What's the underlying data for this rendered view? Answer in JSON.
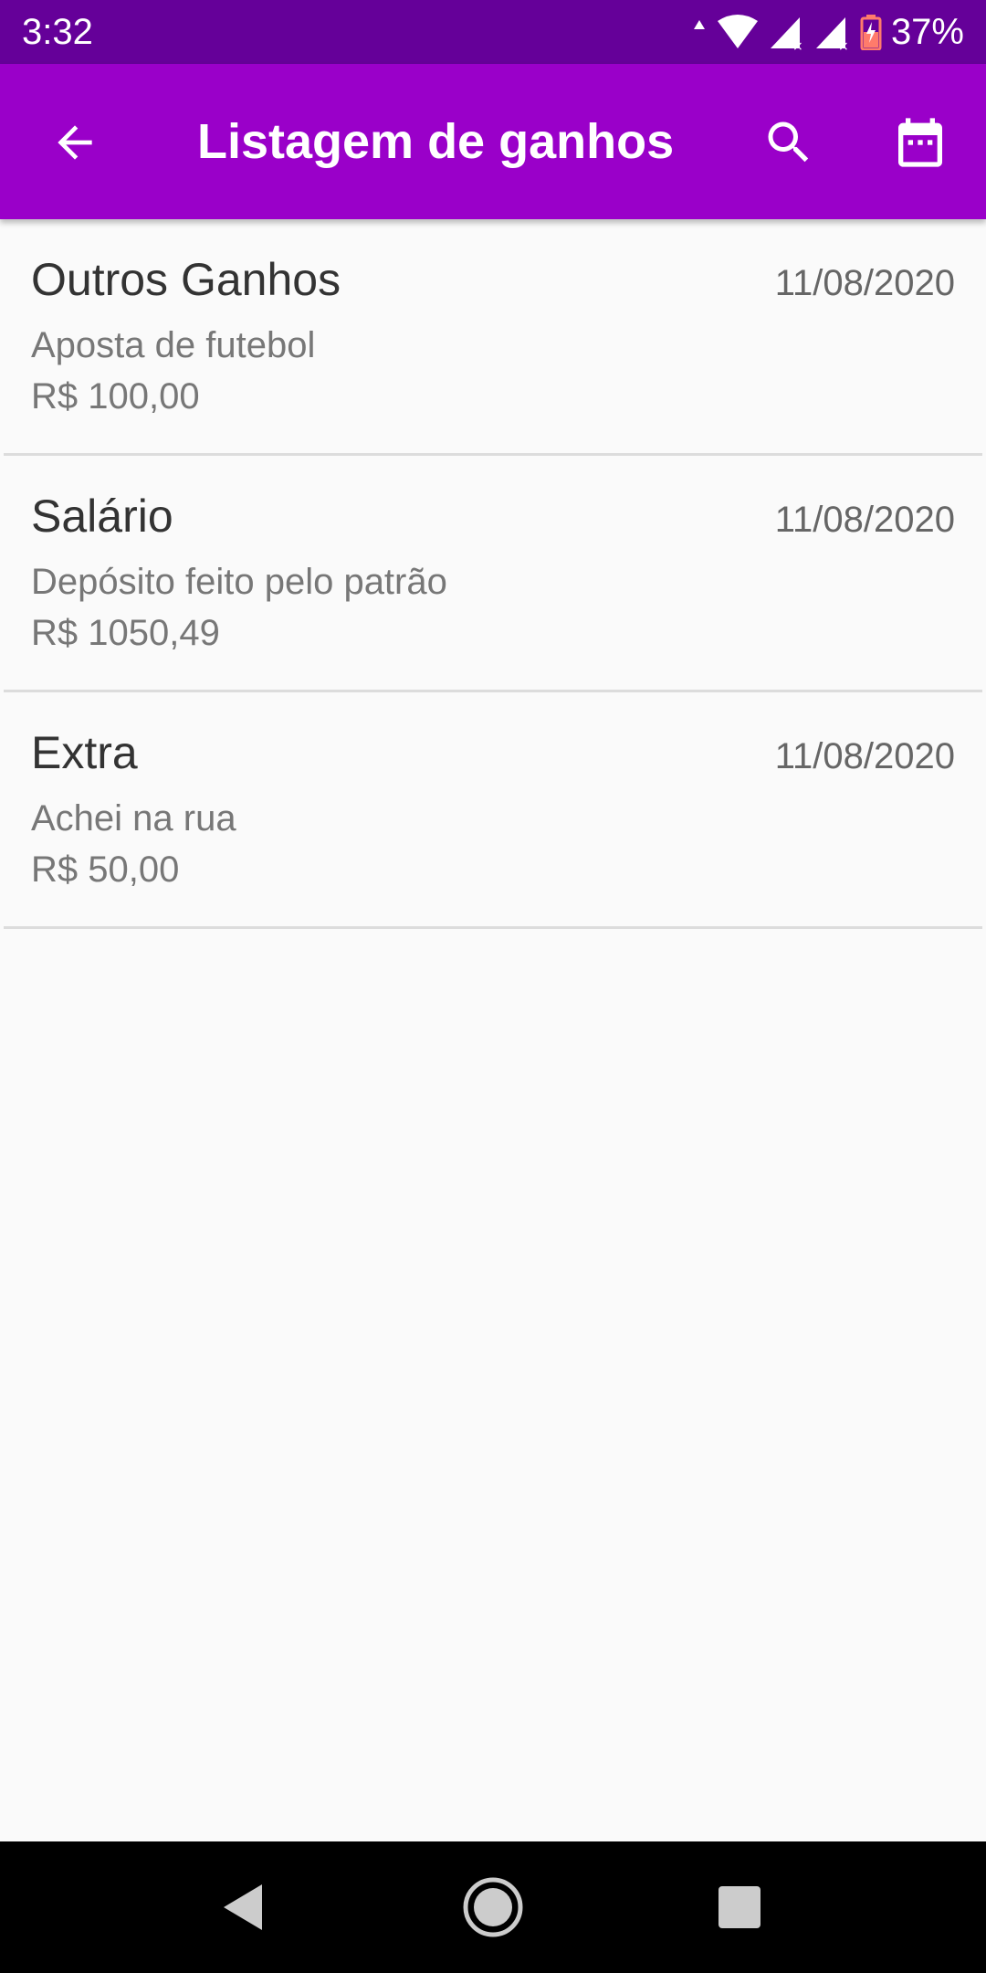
{
  "status_bar": {
    "time": "3:32",
    "battery_percent": "37%",
    "icons": [
      "data-arrows-icon",
      "wifi-icon",
      "signal-icon",
      "signal-icon",
      "battery-charging-icon"
    ]
  },
  "app_bar": {
    "title": "Listagem de ganhos",
    "color": "#9a00c9",
    "icons": [
      "back-arrow-icon",
      "search-icon",
      "calendar-icon"
    ]
  },
  "earnings": [
    {
      "category": "Outros Ganhos",
      "date": "11/08/2020",
      "description": "Aposta de futebol",
      "amount": "R$ 100,00"
    },
    {
      "category": "Salário",
      "date": "11/08/2020",
      "description": "Depósito feito pelo patrão",
      "amount": "R$ 1050,49"
    },
    {
      "category": "Extra",
      "date": "11/08/2020",
      "description": "Achei na rua",
      "amount": "R$ 50,00"
    }
  ],
  "nav_bar": {
    "icons": [
      "nav-back-icon",
      "nav-home-icon",
      "nav-recents-icon"
    ]
  }
}
